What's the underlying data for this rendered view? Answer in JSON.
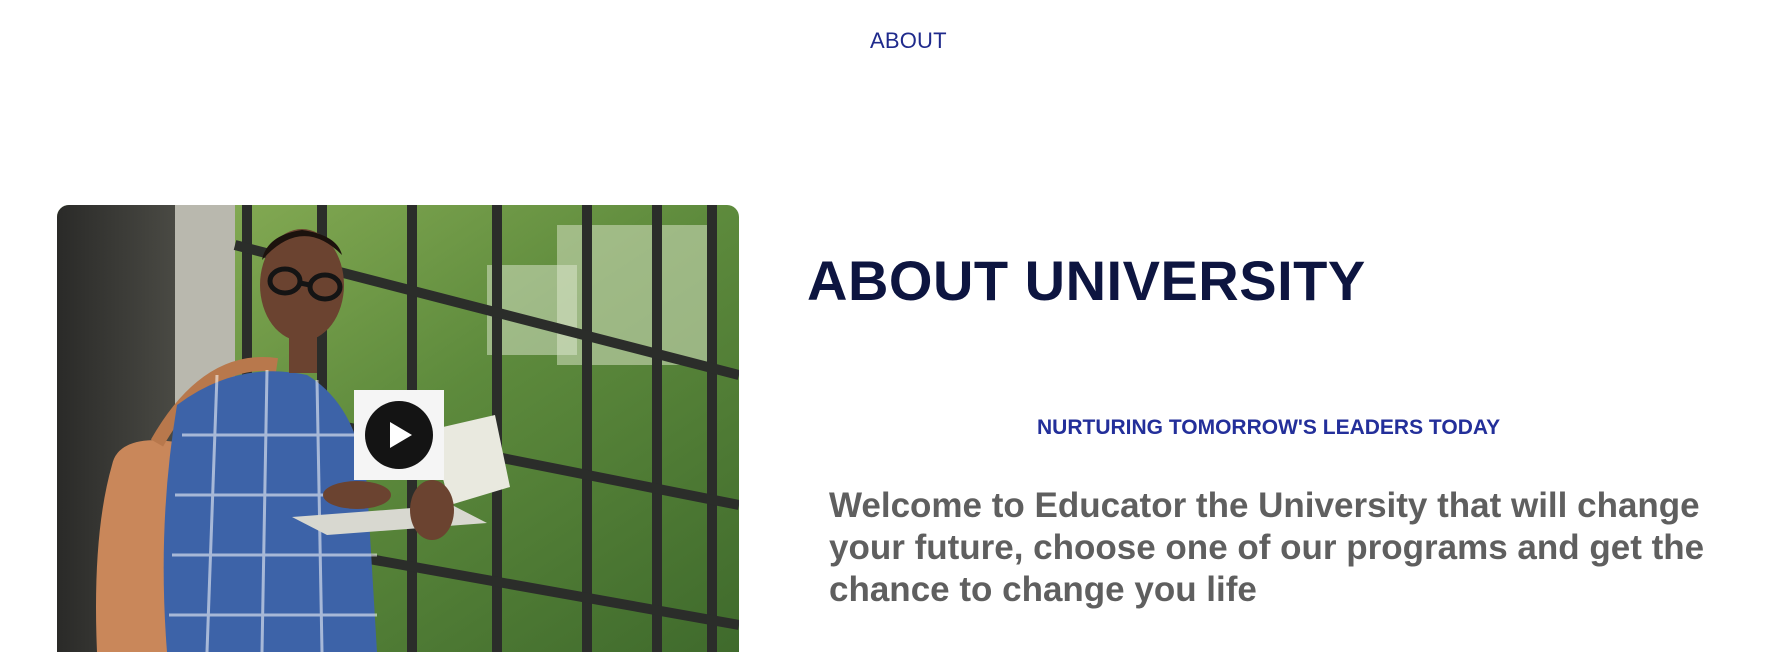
{
  "nav": {
    "about_link": "ABOUT"
  },
  "about": {
    "title": "ABOUT UNIVERSITY",
    "tagline": "NURTURING TOMORROW'S LEADERS TODAY",
    "welcome_text": "Welcome to Educator the University that will change your future, choose one of our programs and get the chance to change you life"
  },
  "media": {
    "play_icon": "play-icon",
    "image_subject": "student-with-laptop-photo"
  },
  "colors": {
    "nav_link": "#1f2a8c",
    "title": "#0d1540",
    "tagline": "#232f9a",
    "body_text": "#5f5f5f",
    "play_button": "#141414"
  }
}
